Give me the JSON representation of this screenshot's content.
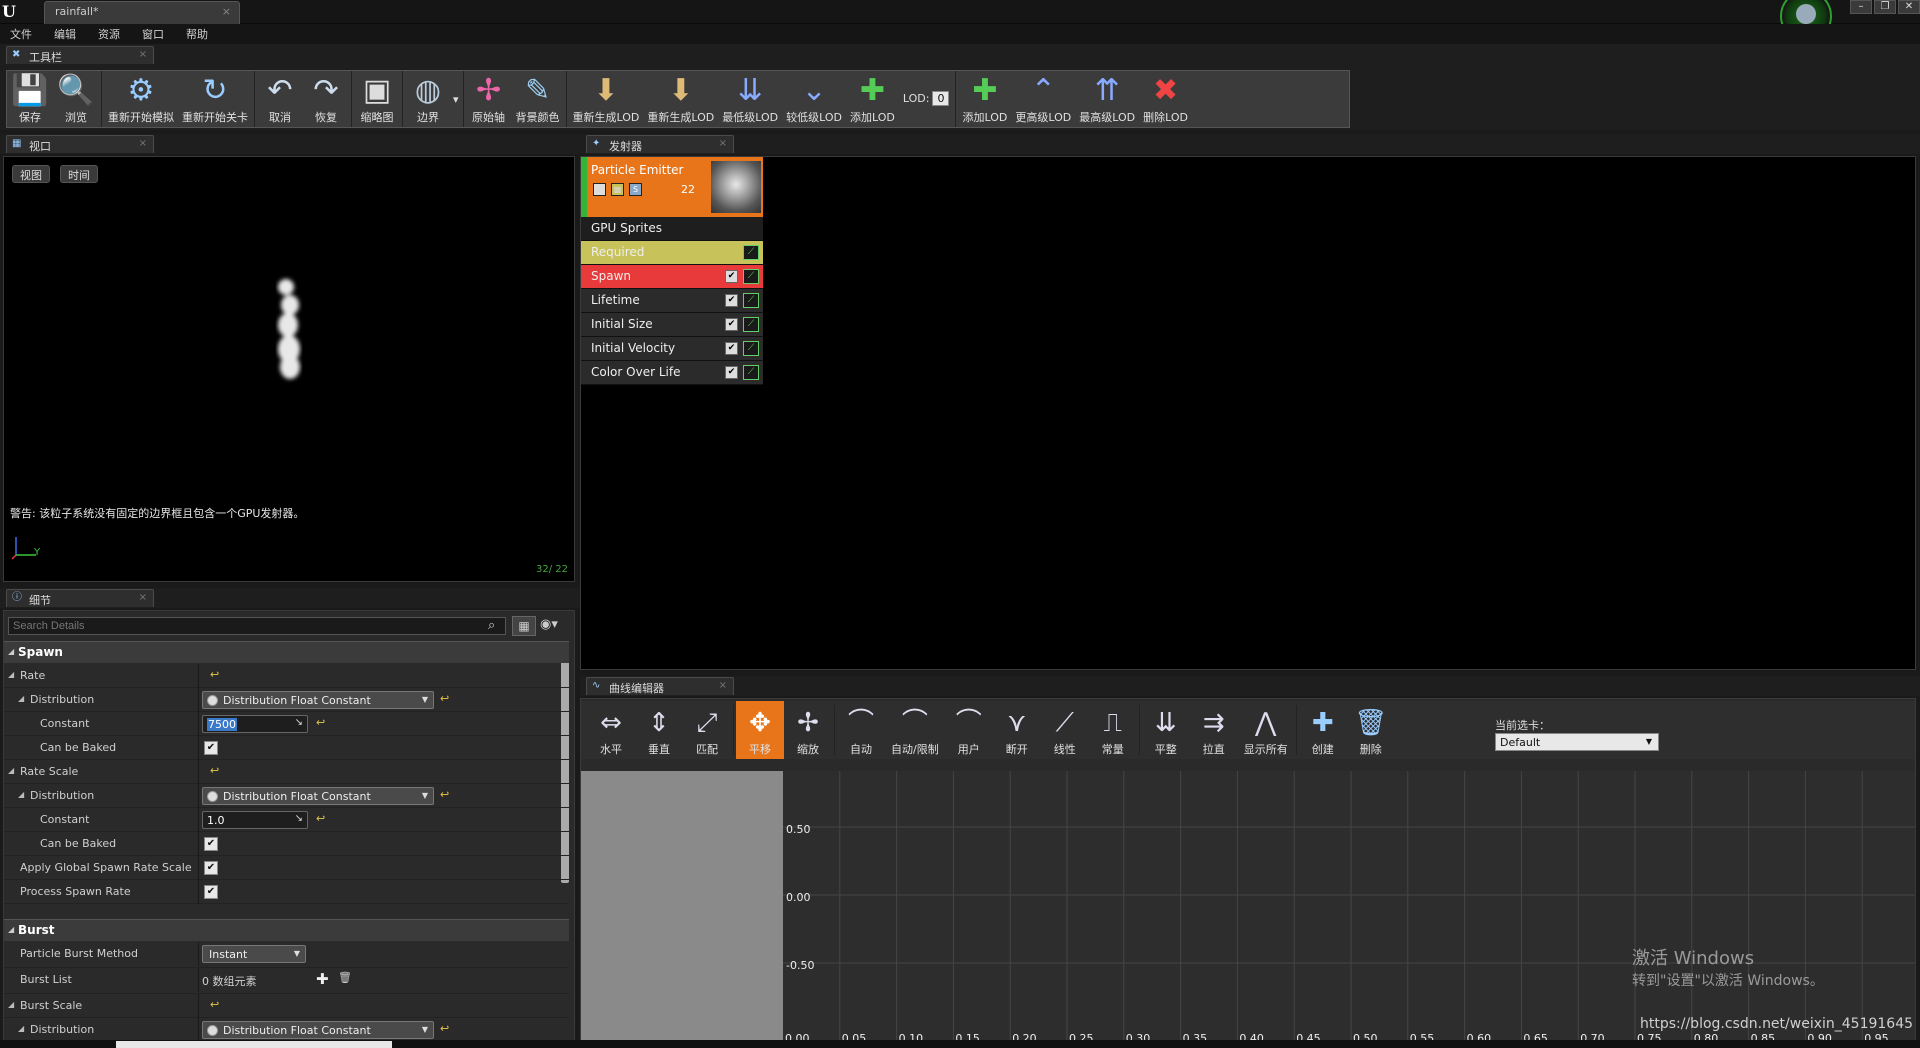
{
  "title_bar": {
    "document_tab": "rainfall*",
    "window_buttons": [
      "–",
      "❐",
      "✕"
    ]
  },
  "menu": [
    "文件",
    "编辑",
    "资源",
    "窗口",
    "帮助"
  ],
  "toolbar_panel": {
    "tab": "工具栏"
  },
  "toolbar": {
    "items": [
      {
        "label": "保存",
        "icon": "save-icon",
        "glyph": "💾"
      },
      {
        "label": "浏览",
        "icon": "browse-icon",
        "glyph": "🔍"
      },
      {
        "label": "重新开始模拟",
        "icon": "restart-sim-icon",
        "glyph": "⚙"
      },
      {
        "label": "重新开始关卡",
        "icon": "restart-level-icon",
        "glyph": "↻"
      },
      {
        "label": "取消",
        "icon": "undo-icon",
        "glyph": "↶"
      },
      {
        "label": "恢复",
        "icon": "redo-icon",
        "glyph": "↷"
      },
      {
        "label": "缩略图",
        "icon": "thumbnail-icon",
        "glyph": "▣"
      },
      {
        "label": "边界",
        "icon": "bounds-icon",
        "glyph": "◍"
      },
      {
        "label": "原始轴",
        "icon": "origin-axis-icon",
        "glyph": "✢"
      },
      {
        "label": "背景颜色",
        "icon": "bg-color-icon",
        "glyph": "✎"
      },
      {
        "label": "重新生成LOD",
        "icon": "regen-lod-icon",
        "glyph": "⬇"
      },
      {
        "label": "重新生成LOD",
        "icon": "regen-lod-2-icon",
        "glyph": "⬇"
      },
      {
        "label": "最低级LOD",
        "icon": "lowest-lod-icon",
        "glyph": "⇊"
      },
      {
        "label": "较低级LOD",
        "icon": "lower-lod-icon",
        "glyph": "⌄"
      },
      {
        "label": "添加LOD",
        "icon": "add-lod-icon",
        "glyph": "✚"
      },
      {
        "label": "添加LOD",
        "icon": "add-lod-up-icon",
        "glyph": "✚"
      },
      {
        "label": "更高级LOD",
        "icon": "higher-lod-icon",
        "glyph": "⌃"
      },
      {
        "label": "最高级LOD",
        "icon": "highest-lod-icon",
        "glyph": "⇈"
      },
      {
        "label": "删除LOD",
        "icon": "delete-lod-icon",
        "glyph": "✖"
      }
    ],
    "lod_label": "LOD:",
    "lod_value": "0"
  },
  "viewport": {
    "tab": "视口",
    "btn_view": "视图",
    "btn_time": "时间",
    "warning": "警告: 该粒子系统没有固定的边界框且包含一个GPU发射器。",
    "counter": "32/ 22",
    "axis_y": "Y"
  },
  "details": {
    "tab": "细节",
    "search_placeholder": "Search Details",
    "spawn_section": "Spawn",
    "rate": "Rate",
    "distribution": "Distribution",
    "dist_value": "Distribution Float Constant",
    "constant": "Constant",
    "rate_constant_value": "7500",
    "can_be_baked": "Can be Baked",
    "rate_scale": "Rate Scale",
    "rate_scale_constant_value": "1.0",
    "apply_global": "Apply Global Spawn Rate Scale",
    "process_spawn": "Process Spawn Rate",
    "burst_section": "Burst",
    "burst_method": "Particle Burst Method",
    "burst_method_value": "Instant",
    "burst_list": "Burst List",
    "burst_list_value": "0 数组元素",
    "burst_scale": "Burst Scale"
  },
  "emitters": {
    "tab": "发射器",
    "emitter_name": "Particle Emitter",
    "emitter_count": "22",
    "type_module": "GPU Sprites",
    "modules": [
      "Required",
      "Spawn",
      "Lifetime",
      "Initial Size",
      "Initial Velocity",
      "Color Over Life"
    ],
    "colors": {
      "required": "#c8c25a",
      "spawn": "#e83a3a",
      "emitter": "#e8751a"
    }
  },
  "curve_editor": {
    "tab": "曲线编辑器",
    "tools": [
      {
        "label": "水平",
        "icon": "fit-horizontal-icon",
        "glyph": "⇔"
      },
      {
        "label": "垂直",
        "icon": "fit-vertical-icon",
        "glyph": "⇕"
      },
      {
        "label": "匹配",
        "icon": "fit-all-icon",
        "glyph": "⤢"
      },
      {
        "label": "平移",
        "icon": "pan-icon",
        "glyph": "✥",
        "active": true
      },
      {
        "label": "缩放",
        "icon": "zoom-icon",
        "glyph": "✢"
      },
      {
        "label": "自动",
        "icon": "auto-tangent-icon",
        "glyph": "⌒"
      },
      {
        "label": "自动/限制",
        "icon": "auto-clamp-icon",
        "glyph": "⌒"
      },
      {
        "label": "用户",
        "icon": "user-tangent-icon",
        "glyph": "⌒"
      },
      {
        "label": "断开",
        "icon": "break-tangent-icon",
        "glyph": "⋎"
      },
      {
        "label": "线性",
        "icon": "linear-icon",
        "glyph": "⟋"
      },
      {
        "label": "常量",
        "icon": "constant-icon",
        "glyph": "⎍"
      },
      {
        "label": "平整",
        "icon": "flatten-icon",
        "glyph": "⇊"
      },
      {
        "label": "拉直",
        "icon": "straighten-icon",
        "glyph": "⇉"
      },
      {
        "label": "显示所有",
        "icon": "show-all-icon",
        "glyph": "⋀"
      },
      {
        "label": "创建",
        "icon": "create-icon",
        "glyph": "✚"
      },
      {
        "label": "删除",
        "icon": "delete-icon",
        "glyph": "🗑"
      }
    ],
    "current_tab_label": "当前选卡：",
    "current_tab_value": "Default",
    "y_labels": [
      "0.50",
      "0.00",
      "-0.50"
    ],
    "x_labels": [
      "0.00",
      "0.05",
      "0.10",
      "0.15",
      "0.20",
      "0.25",
      "0.30",
      "0.35",
      "0.40",
      "0.45",
      "0.50",
      "0.55",
      "0.60",
      "0.65",
      "0.70",
      "0.75",
      "0.80",
      "0.85",
      "0.90",
      "0.95"
    ]
  },
  "watermark": {
    "line1": "激活 Windows",
    "line2": "转到\"设置\"以激活 Windows。"
  },
  "csdn": "https://blog.csdn.net/weixin_45191645"
}
